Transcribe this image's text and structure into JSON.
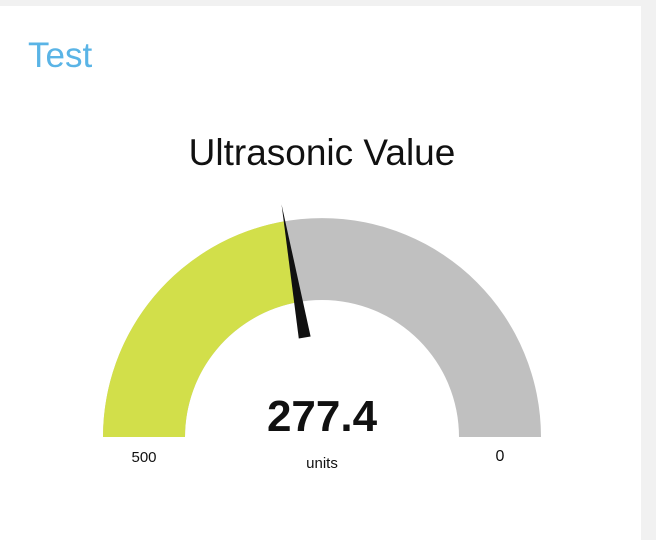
{
  "card": {
    "title": "Test"
  },
  "gauge": {
    "title": "Ultrasonic Value",
    "value": 277.4,
    "value_label": "277.4",
    "unit": "units",
    "left_label": "500",
    "right_label": "0",
    "range": {
      "min": 0,
      "max": 500,
      "direction": "right-to-left"
    },
    "colors": {
      "fill": "#d2df4a",
      "track": "#c0c0c0",
      "needle": "#111111",
      "title_accent": "#5ab4e6"
    }
  }
}
